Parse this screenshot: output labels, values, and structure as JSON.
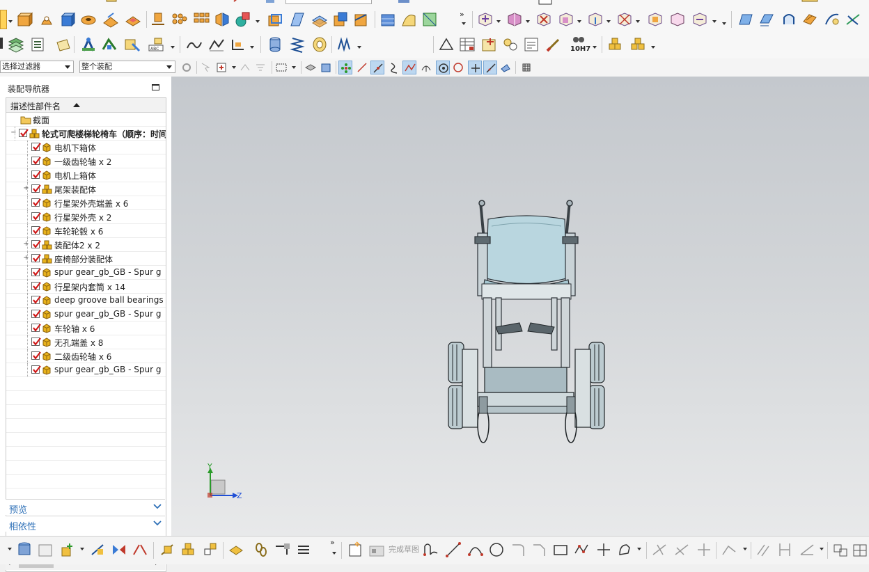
{
  "selection_bar": {
    "filter_label": "选择过滤器",
    "scope_label": "整个装配"
  },
  "ribbon": {
    "row3_text_10h7": "10H7",
    "row2_more": "»"
  },
  "navigator": {
    "title": "装配导航器",
    "column_header": "描述性部件名",
    "items": [
      {
        "label": "截面",
        "level": 0,
        "icon": "folder-icon",
        "checked": false,
        "expand": ""
      },
      {
        "label": "轮式可爬楼梯轮椅车（顺序：时间",
        "level": 0,
        "icon": "assembly-icon",
        "checked": true,
        "expand": "−",
        "bold": true
      },
      {
        "label": "电机下箱体",
        "level": 1,
        "icon": "part-icon",
        "checked": true,
        "expand": ""
      },
      {
        "label": "一级齿轮轴 x 2",
        "level": 1,
        "icon": "part-icon",
        "checked": true,
        "expand": ""
      },
      {
        "label": "电机上箱体",
        "level": 1,
        "icon": "part-icon",
        "checked": true,
        "expand": ""
      },
      {
        "label": "尾架装配体",
        "level": 1,
        "icon": "assembly-icon",
        "checked": true,
        "expand": "+"
      },
      {
        "label": "行星架外壳端盖 x 6",
        "level": 1,
        "icon": "part-icon",
        "checked": true,
        "expand": ""
      },
      {
        "label": "行星架外壳 x 2",
        "level": 1,
        "icon": "part-icon",
        "checked": true,
        "expand": ""
      },
      {
        "label": "车轮轮毂 x 6",
        "level": 1,
        "icon": "part-icon",
        "checked": true,
        "expand": ""
      },
      {
        "label": "装配体2 x 2",
        "level": 1,
        "icon": "assembly-icon",
        "checked": true,
        "expand": "+"
      },
      {
        "label": "座椅部分装配体",
        "level": 1,
        "icon": "assembly-icon",
        "checked": true,
        "expand": "+"
      },
      {
        "label": "spur gear_gb_GB - Spur g",
        "level": 1,
        "icon": "part-icon",
        "checked": true,
        "expand": ""
      },
      {
        "label": "行星架内套筒 x 14",
        "level": 1,
        "icon": "part-icon",
        "checked": true,
        "expand": ""
      },
      {
        "label": "deep groove ball bearings",
        "level": 1,
        "icon": "part-icon",
        "checked": true,
        "expand": ""
      },
      {
        "label": "spur gear_gb_GB - Spur g",
        "level": 1,
        "icon": "part-icon",
        "checked": true,
        "expand": ""
      },
      {
        "label": "车轮轴 x 6",
        "level": 1,
        "icon": "part-icon",
        "checked": true,
        "expand": ""
      },
      {
        "label": "无孔端盖 x 8",
        "level": 1,
        "icon": "part-icon",
        "checked": true,
        "expand": ""
      },
      {
        "label": "二级齿轮轴 x 6",
        "level": 1,
        "icon": "part-icon",
        "checked": true,
        "expand": ""
      },
      {
        "label": "spur gear_gb_GB - Spur g",
        "level": 1,
        "icon": "part-icon",
        "checked": true,
        "expand": ""
      }
    ],
    "preview_label": "预览",
    "dependency_label": "相依性"
  },
  "viewport": {
    "axis_y": "Y",
    "axis_z": "Z"
  },
  "bottom_toolbar": {
    "finish_sketch_label": "完成草图",
    "more": "»"
  },
  "colors": {
    "accent_blue": "#2c6fb7",
    "check_red": "#d01818",
    "part_yellow": "#e8b21c",
    "viewport_top": "#c4c8cd",
    "viewport_bottom": "#e8e9ea",
    "model_seat": "#b9d6df"
  }
}
